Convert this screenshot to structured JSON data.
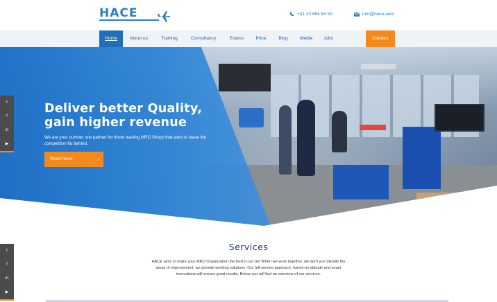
{
  "brand": {
    "logo_text": "HACE"
  },
  "header": {
    "phone": "+31 20 864 64 92",
    "email": "info@hace.aero"
  },
  "nav": {
    "items": [
      {
        "label": "Home",
        "active": true
      },
      {
        "label": "About us"
      },
      {
        "label": "Training"
      },
      {
        "label": "Consultancy"
      },
      {
        "label": "Exams"
      },
      {
        "label": "Price"
      },
      {
        "label": "Blog"
      },
      {
        "label": "Media"
      },
      {
        "label": "Jobs"
      }
    ],
    "contact_label": "Contact"
  },
  "hero": {
    "title_line1": "Deliver better Quality,",
    "title_line2": "gain higher revenue",
    "subtitle": "We are your number one partner for those leading MRO Shops that want to leave the competition far behind.",
    "button_label": "Read more"
  },
  "social": {
    "icons": [
      "twitter-icon",
      "facebook-icon",
      "linkedin-icon",
      "youtube-icon"
    ],
    "labels": [
      "t",
      "f",
      "in",
      "▶"
    ]
  },
  "services": {
    "title": "Services",
    "text": "HACE aims to make your MRO Organization the best it can be! When we work together, we don't just identify the areas of improvement, we provide working solutions. Our full-service approach, hands-on attitude and smart innovations will ensure great results. Below you will find an overview of our services."
  },
  "colors": {
    "brand_blue": "#1f6fba",
    "accent_orange": "#f48a1e",
    "dark_navy": "#1b3a6b"
  }
}
